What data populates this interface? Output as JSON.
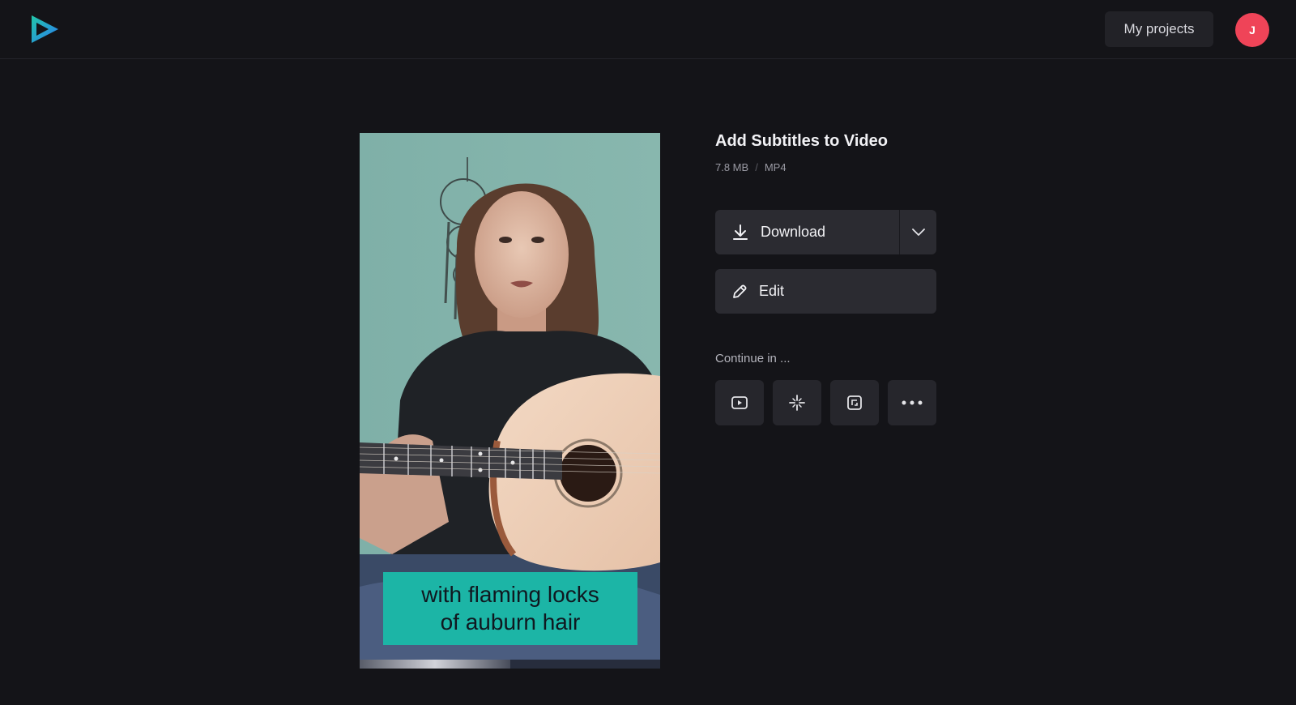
{
  "header": {
    "logo_icon": "play-logo-icon",
    "my_projects_label": "My projects",
    "avatar_initial": "J",
    "avatar_color": "#ef4458"
  },
  "video": {
    "caption_line1": "with flaming locks",
    "caption_line2": "of auburn hair",
    "caption_bg_color": "#1cb5a6",
    "progress_fraction": 0.5
  },
  "details": {
    "title": "Add Subtitles to Video",
    "file_size": "7.8 MB",
    "separator": "/",
    "format": "MP4"
  },
  "actions": {
    "download_label": "Download",
    "download_icon": "download-icon",
    "download_menu_icon": "chevron-down-icon",
    "edit_label": "Edit",
    "edit_icon": "pencil-icon"
  },
  "continue_in": {
    "label": "Continue in ...",
    "tools": [
      {
        "icon": "video-player-icon"
      },
      {
        "icon": "sparkle-icon"
      },
      {
        "icon": "resize-icon"
      },
      {
        "icon": "more-icon"
      }
    ]
  },
  "colors": {
    "background": "#141418",
    "button_bg": "#2b2b31",
    "tool_bg": "#26262c"
  }
}
